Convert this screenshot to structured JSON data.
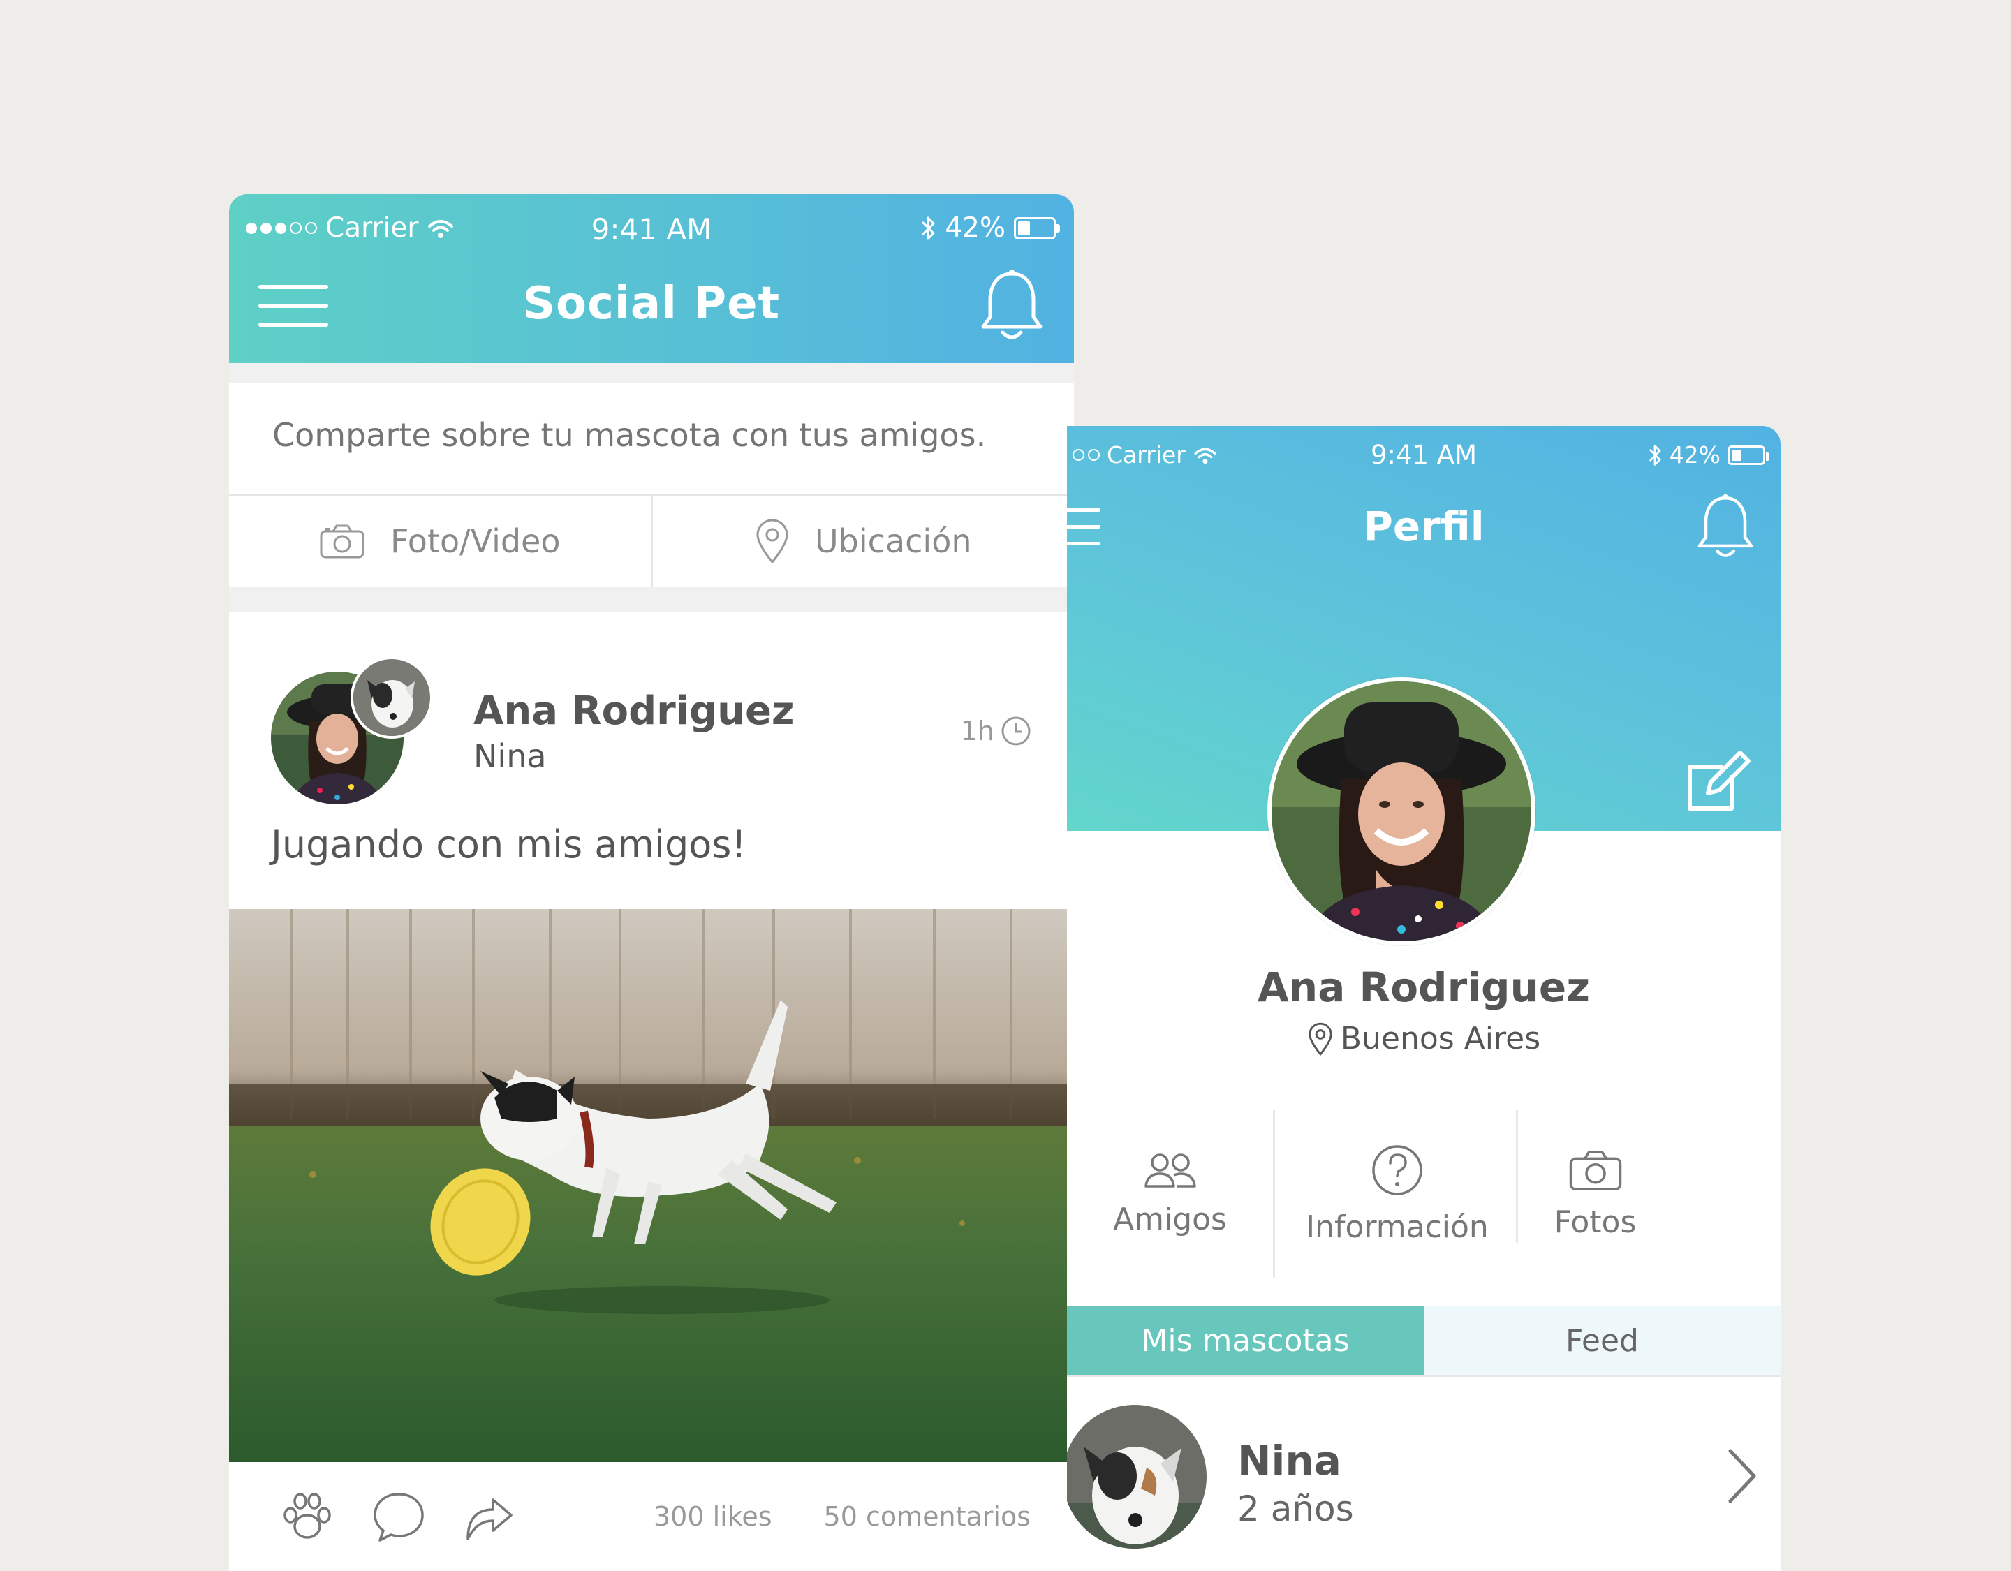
{
  "feed_screen": {
    "status": {
      "carrier": "Carrier",
      "time": "9:41 AM",
      "battery": "42%",
      "battery_level": 0.42
    },
    "header": {
      "title": "Social Pet",
      "menu_icon": "hamburger-icon",
      "notifications_icon": "bell-icon"
    },
    "composer": {
      "placeholder": "Comparte sobre tu mascota con tus amigos.",
      "photo_label": "Foto/Video",
      "location_label": "Ubicación"
    },
    "post": {
      "author": "Ana Rodriguez",
      "pet": "Nina",
      "time": "1h",
      "text": "Jugando con mis amigos!",
      "likes": "300 likes",
      "comments": "50 comentarios"
    }
  },
  "profile_screen": {
    "status": {
      "carrier": "Carrier",
      "time": "9:41 AM",
      "battery": "42%",
      "battery_level": 0.42
    },
    "header": {
      "title": "Perfil"
    },
    "user": {
      "name": "Ana Rodriguez",
      "location": "Buenos Aires"
    },
    "menu": [
      {
        "label": "Amigos",
        "icon": "friends-icon"
      },
      {
        "label": "Información",
        "icon": "info-icon"
      },
      {
        "label": "Fotos",
        "icon": "camera-icon"
      }
    ],
    "tabs": [
      {
        "label": "Mis mascotas",
        "active": true
      },
      {
        "label": "Feed",
        "active": false
      }
    ],
    "pets": [
      {
        "name": "Nina",
        "age": "2 años"
      }
    ]
  },
  "colors": {
    "header_start": "#5ed0c6",
    "header_end": "#52b2e2",
    "tab_active": "#68c7bd",
    "background": "#eeedea"
  }
}
